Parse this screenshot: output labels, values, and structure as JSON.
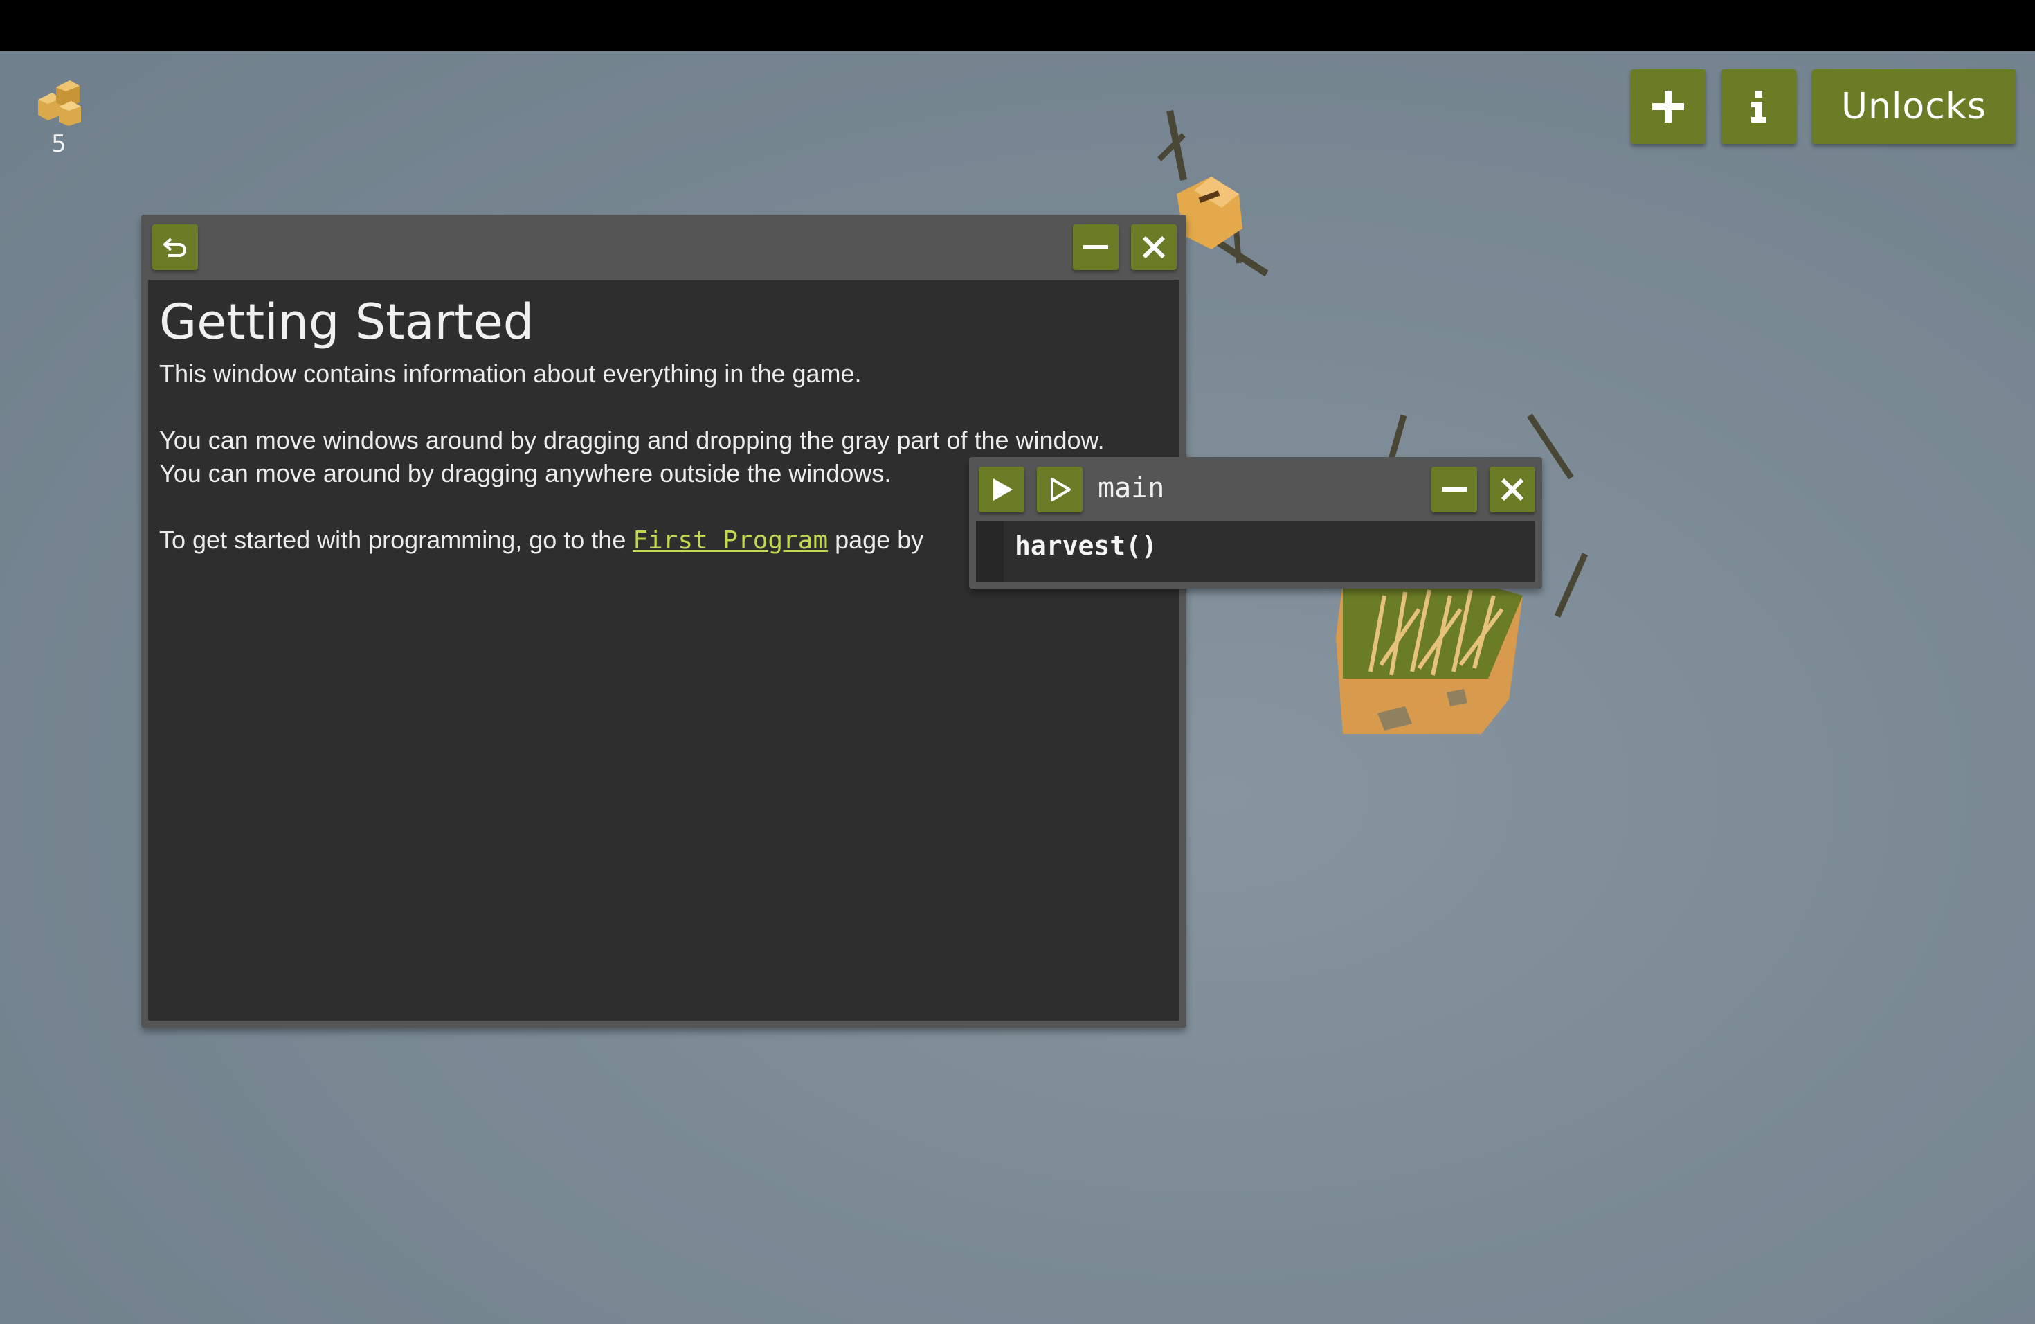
{
  "hud": {
    "resource_icon": "hay-bales-icon",
    "resource_count": "5"
  },
  "toolbar": {
    "add_icon": "plus-icon",
    "info_icon": "info-icon",
    "unlocks_label": "Unlocks",
    "button_color": "#6b7c26"
  },
  "info_window": {
    "back_icon": "back-arrow-icon",
    "minimize_icon": "minimize-icon",
    "close_icon": "close-icon",
    "title": "Getting Started",
    "line1": "This window contains information about everything in the game.",
    "line2": "You can move windows around by dragging and dropping the gray part of the window.",
    "line3": "You can move around by dragging anywhere outside the windows.",
    "line4_prefix": "To get started with programming, go to the ",
    "line4_link": "First Program",
    "line4_suffix": " page by",
    "link_color": "#c2d64e"
  },
  "code_window": {
    "run_icon": "play-filled-icon",
    "step_icon": "play-outline-icon",
    "title": "main",
    "minimize_icon": "minimize-icon",
    "close_icon": "close-icon",
    "code": "harvest()"
  }
}
